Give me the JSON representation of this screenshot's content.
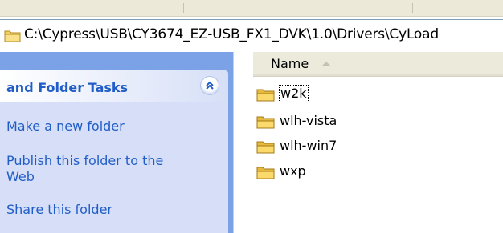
{
  "address": {
    "path": "C:\\Cypress\\USB\\CY3674_EZ-USB_FX1_DVK\\1.0\\Drivers\\CyLoad"
  },
  "task_pane": {
    "title": "and Folder Tasks",
    "links": [
      {
        "label": "Make a new folder"
      },
      {
        "label": "Publish this folder to the Web"
      },
      {
        "label": "Share this folder"
      }
    ]
  },
  "file_list": {
    "column": "Name",
    "sort": "ascending",
    "items": [
      {
        "name": "w2k",
        "focused": true
      },
      {
        "name": "wlh-vista",
        "focused": false
      },
      {
        "name": "wlh-win7",
        "focused": false
      },
      {
        "name": "wxp",
        "focused": false
      }
    ]
  },
  "colors": {
    "link": "#215dc6",
    "pane_bg": "#7ba2e7",
    "task_body": "#d6dff7",
    "folder": "#f2cf5b"
  },
  "icons": {
    "address": "folder-icon",
    "collapse": "double-chevron-up-icon",
    "sort": "sort-ascending-icon",
    "item": "folder-icon"
  }
}
